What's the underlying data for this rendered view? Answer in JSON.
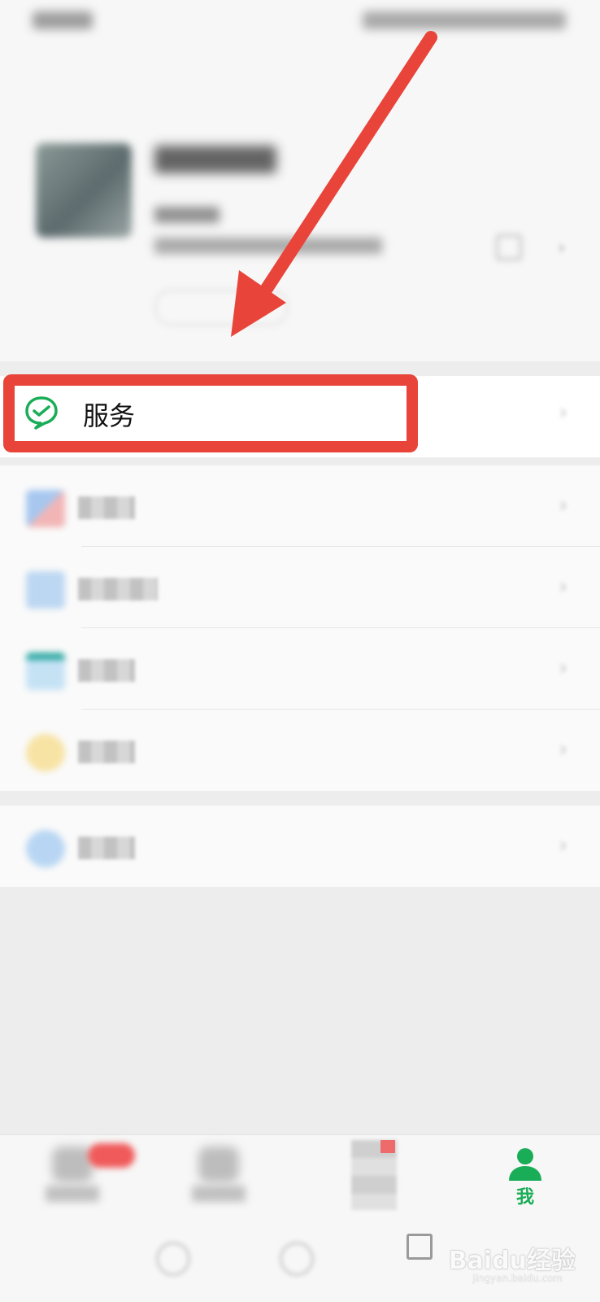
{
  "colors": {
    "highlight": "#e8443a",
    "wechat_green": "#1aad57",
    "background": "#ededed",
    "row_background": "#ffffff"
  },
  "service_row": {
    "label": "服务",
    "icon": "wechat-pay-icon"
  },
  "tabbar": {
    "me_label": "我",
    "me_icon": "person-icon"
  },
  "watermark": {
    "brand": "Baidu经验",
    "url": "jingyan.baidu.com"
  }
}
